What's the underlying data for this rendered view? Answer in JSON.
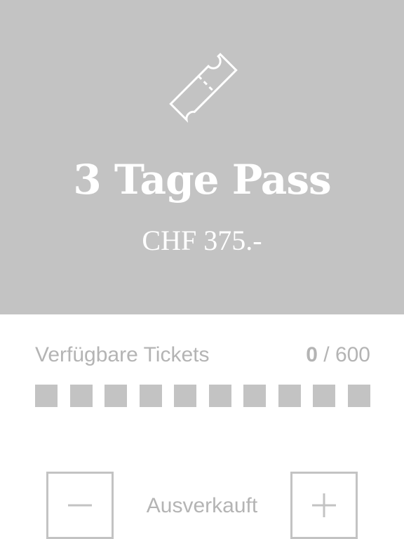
{
  "product": {
    "title": "3 Tage Pass",
    "price": "CHF 375.-",
    "icon": "ticket-icon"
  },
  "availability": {
    "label": "Verfügbare Tickets",
    "sold": "0",
    "separator": "/",
    "total": "600",
    "level_fraction": 0,
    "indicator_segments": 10
  },
  "stepper": {
    "minus_icon": "minus-icon",
    "plus_icon": "plus-icon",
    "status": "Ausverkauft"
  },
  "colors": {
    "hero_background": "#c3c3c3",
    "text_on_hero": "#ffffff",
    "muted_text": "#b4b4b4",
    "indicator": "#c3c3c3"
  }
}
